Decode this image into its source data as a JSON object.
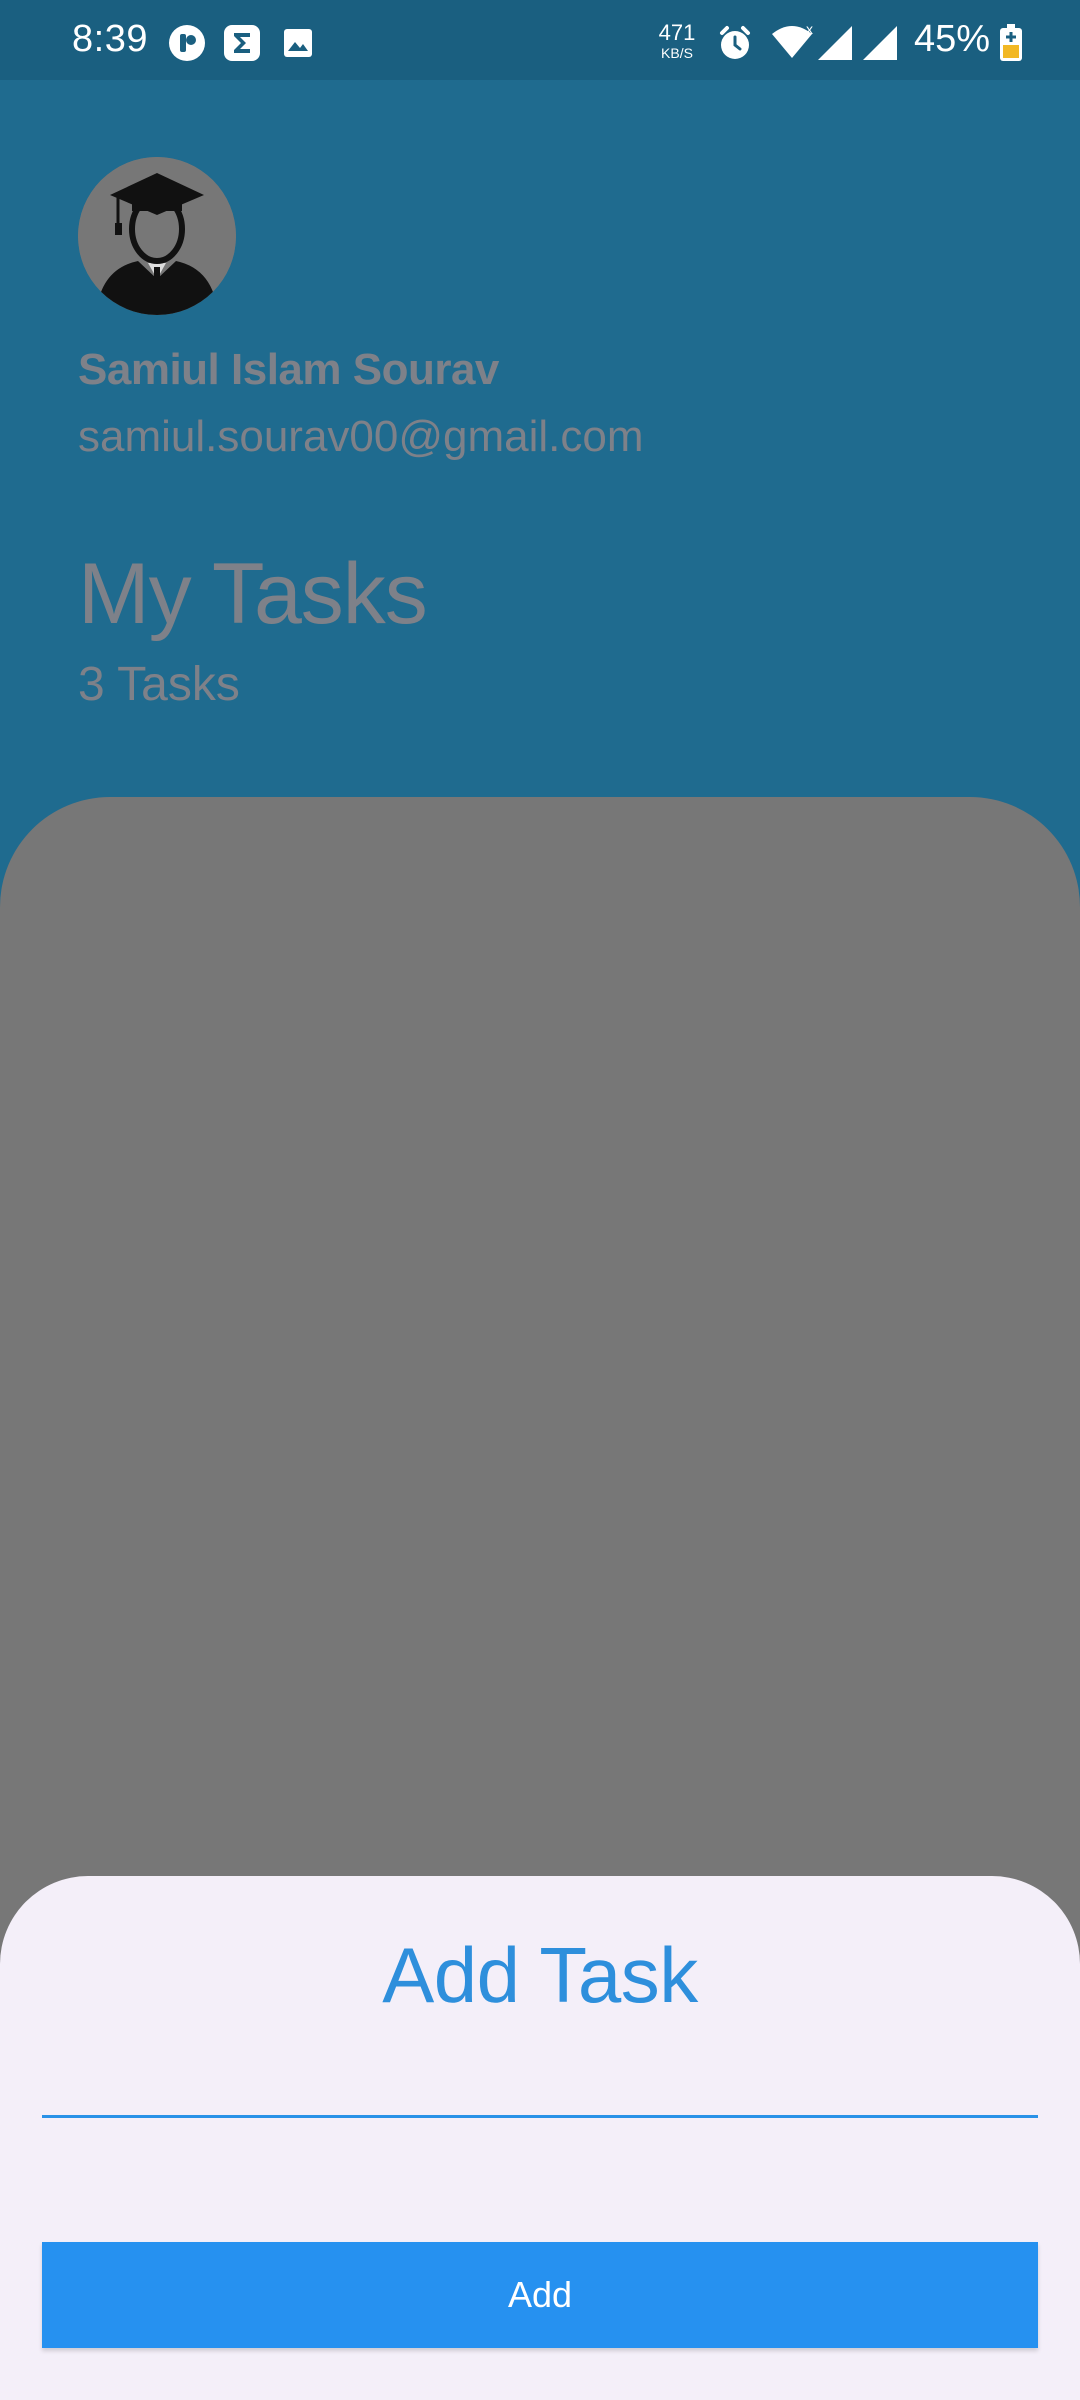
{
  "status_bar": {
    "time": "8:39",
    "net_speed_value": "471",
    "net_speed_unit": "KB/S",
    "battery_percent": "45%",
    "icons": [
      "app-notification-icon",
      "sigma-app-icon",
      "image-icon",
      "alarm-icon",
      "wifi-icon",
      "cell-signal-icon",
      "cell-signal-icon",
      "battery-charging-icon"
    ]
  },
  "profile": {
    "avatar_icon": "graduate-avatar-icon",
    "name": "Samiul Islam Sourav",
    "email": "samiul.sourav00@gmail.com"
  },
  "tasks": {
    "title": "My Tasks",
    "count_label": "3 Tasks"
  },
  "add_task_sheet": {
    "title": "Add Task",
    "input_value": "",
    "input_placeholder": "",
    "button_label": "Add"
  },
  "colors": {
    "header_bg": "#1f6b8f",
    "status_bar_bg": "#1a5f80",
    "dimmed_panel": "#777777",
    "sheet_bg": "#f4eff9",
    "accent": "#2691f0",
    "title_blue": "#2e8fdc"
  }
}
